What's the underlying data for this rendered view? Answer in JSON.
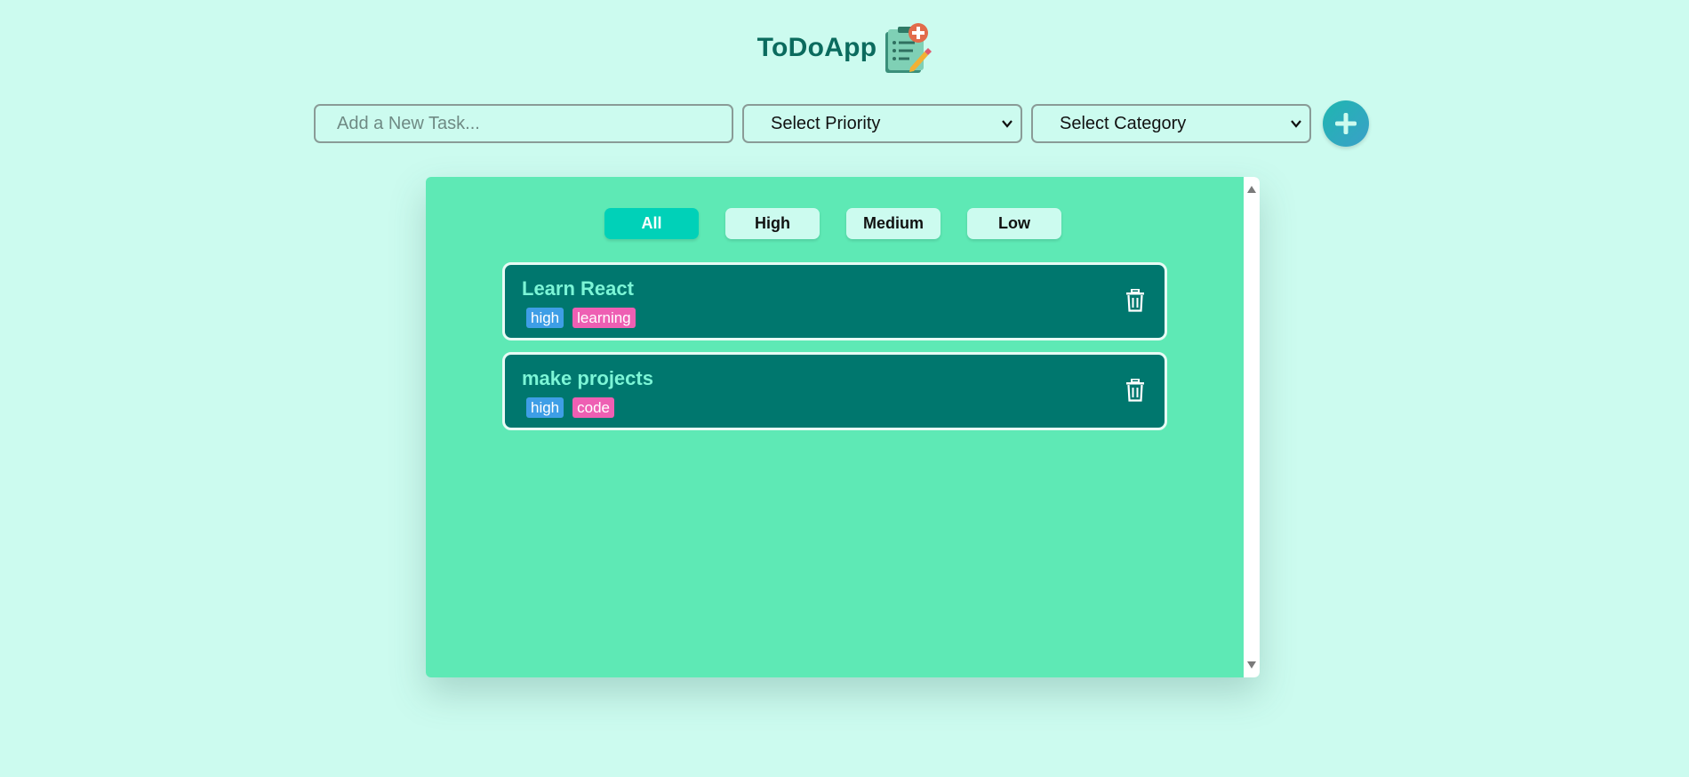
{
  "app": {
    "title": "ToDoApp",
    "logo_icon": "clipboard-plus-pencil-icon"
  },
  "toolbar": {
    "task_placeholder": "Add a New Task...",
    "task_value": "",
    "priority_select": "Select Priority",
    "category_select": "Select Category",
    "add_icon": "plus-icon"
  },
  "filters": [
    {
      "label": "All",
      "active": true
    },
    {
      "label": "High",
      "active": false
    },
    {
      "label": "Medium",
      "active": false
    },
    {
      "label": "Low",
      "active": false
    }
  ],
  "tasks": [
    {
      "title": "Learn React",
      "priority": "high",
      "category": "learning"
    },
    {
      "title": "make projects",
      "priority": "high",
      "category": "code"
    }
  ],
  "colors": {
    "background": "#ccfbef",
    "panel": "#5ee9b5",
    "task_card": "#00776e",
    "task_title": "#7cf5d6",
    "active_filter": "#00d1b8",
    "priority_tag": "#3e9ee6",
    "category_tag": "#ee5fb3",
    "title_text": "#0b6b5e"
  }
}
